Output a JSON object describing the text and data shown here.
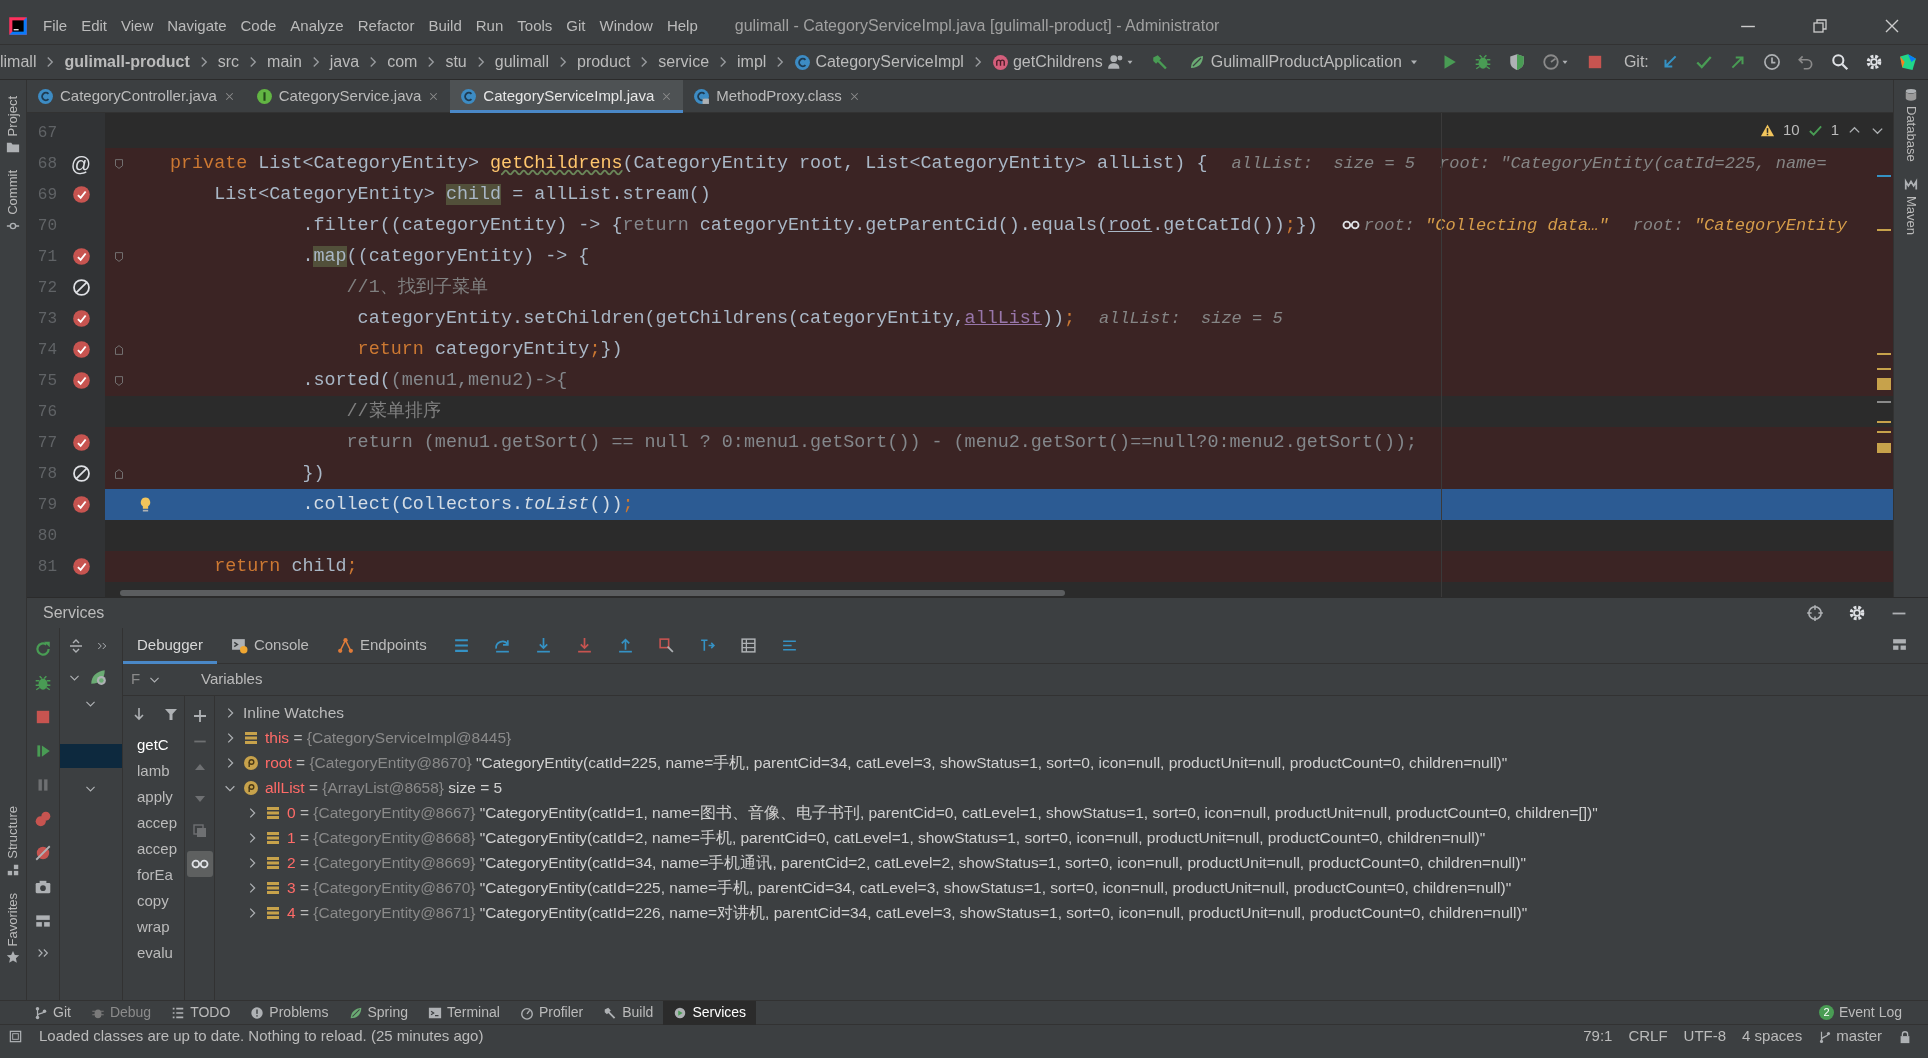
{
  "window": {
    "title": "gulimall - CategoryServiceImpl.java [gulimall-product] - Administrator"
  },
  "menu": [
    "File",
    "Edit",
    "View",
    "Navigate",
    "Code",
    "Analyze",
    "Refactor",
    "Build",
    "Run",
    "Tools",
    "Git",
    "Window",
    "Help"
  ],
  "breadcrumbs": [
    {
      "label": "limall",
      "kind": "project"
    },
    {
      "label": "gulimall-product",
      "kind": "module"
    },
    {
      "label": "src",
      "kind": "folder"
    },
    {
      "label": "main",
      "kind": "folder"
    },
    {
      "label": "java",
      "kind": "folder"
    },
    {
      "label": "com",
      "kind": "folder"
    },
    {
      "label": "stu",
      "kind": "folder"
    },
    {
      "label": "gulimall",
      "kind": "folder"
    },
    {
      "label": "product",
      "kind": "folder"
    },
    {
      "label": "service",
      "kind": "folder"
    },
    {
      "label": "impl",
      "kind": "folder"
    },
    {
      "label": "CategoryServiceImpl",
      "kind": "class"
    },
    {
      "label": "getChildrens",
      "kind": "method"
    }
  ],
  "run_config": "GulimallProductApplication",
  "git_label": "Git:",
  "tabs": [
    {
      "label": "CategoryController.java",
      "kind": "class",
      "selected": false
    },
    {
      "label": "CategoryService.java",
      "kind": "interface",
      "selected": false
    },
    {
      "label": "CategoryServiceImpl.java",
      "kind": "class",
      "selected": true
    },
    {
      "label": "MethodProxy.class",
      "kind": "compiled",
      "selected": false
    }
  ],
  "inspections": {
    "warnings": "10",
    "ok": "1"
  },
  "lines": [
    {
      "number": "67",
      "kind": "plain",
      "highlighted": false,
      "current": false,
      "fold_start": false,
      "fold_end": false,
      "bulb": false
    },
    {
      "number": "68",
      "kind": "symbol",
      "symbol": "@",
      "highlighted": true,
      "current": false,
      "fold_start": true,
      "fold_end": false,
      "bulb": false,
      "code": [
        {
          "kind": "keyword",
          "text": "private"
        },
        {
          "kind": "plain",
          "text": " List<CategoryEntity> "
        },
        {
          "kind": "typo",
          "text": "getChildrens"
        },
        {
          "kind": "plain",
          "text": "(CategoryEntity root, List<CategoryEntity> allList) {"
        }
      ],
      "hints": [
        {
          "kind": "value",
          "segments": [
            {
              "kind": "label",
              "text": "allList:  size = 5"
            }
          ]
        },
        {
          "kind": "value",
          "segments": [
            {
              "kind": "label",
              "text": "root: \"CategoryEntity(catId=225, name="
            }
          ]
        }
      ]
    },
    {
      "number": "69",
      "kind": "breakpoint",
      "highlighted": true,
      "current": false,
      "fold_start": false,
      "fold_end": false,
      "bulb": false,
      "code": [
        {
          "kind": "plain",
          "text": "    List<CategoryEntity> "
        },
        {
          "kind": "highlight",
          "text": "child"
        },
        {
          "kind": "plain",
          "text": " = allList.stream()"
        }
      ]
    },
    {
      "number": "70",
      "kind": "plain",
      "highlighted": true,
      "current": false,
      "fold_start": false,
      "fold_end": false,
      "bulb": false,
      "code": [
        {
          "kind": "plain",
          "text": "            .filter((categoryEntity) -> {"
        },
        {
          "kind": "dim",
          "text": "return"
        },
        {
          "kind": "plain",
          "text": " categoryEntity.getParentCid().equals("
        },
        {
          "kind": "param",
          "text": "root"
        },
        {
          "kind": "plain",
          "text": ".getCatId())"
        },
        {
          "kind": "keyword",
          "text": ";"
        },
        {
          "kind": "plain",
          "text": "})"
        }
      ],
      "hints": [
        {
          "kind": "watch",
          "segments": [
            {
              "kind": "label",
              "text": "root: "
            },
            {
              "kind": "value",
              "text": "\"Collecting data…\""
            }
          ]
        },
        {
          "kind": "value",
          "segments": [
            {
              "kind": "label",
              "text": "root: "
            },
            {
              "kind": "value",
              "text": "\"CategoryEntity"
            }
          ]
        }
      ]
    },
    {
      "number": "71",
      "kind": "breakpoint",
      "highlighted": true,
      "current": false,
      "fold_start": true,
      "fold_end": false,
      "bulb": false,
      "code": [
        {
          "kind": "plain",
          "text": "            ."
        },
        {
          "kind": "highlight",
          "text": "map"
        },
        {
          "kind": "plain",
          "text": "((categoryEntity) -> {"
        }
      ]
    },
    {
      "number": "72",
      "kind": "disabled-breakpoint",
      "highlighted": true,
      "current": false,
      "fold_start": false,
      "fold_end": false,
      "bulb": false,
      "code": [
        {
          "kind": "comment",
          "text": "                //1、找到子菜单"
        }
      ]
    },
    {
      "number": "73",
      "kind": "breakpoint",
      "highlighted": true,
      "current": false,
      "fold_start": false,
      "fold_end": false,
      "bulb": false,
      "code": [
        {
          "kind": "plain",
          "text": "                 categoryEntity.setChildren(getChildrens(categoryEntity,"
        },
        {
          "kind": "field",
          "text": "allList"
        },
        {
          "kind": "plain",
          "text": "))"
        },
        {
          "kind": "keyword",
          "text": ";"
        }
      ],
      "hints": [
        {
          "kind": "value",
          "segments": [
            {
              "kind": "label",
              "text": "allList:  size = 5"
            }
          ]
        }
      ]
    },
    {
      "number": "74",
      "kind": "breakpoint",
      "highlighted": true,
      "current": false,
      "fold_start": false,
      "fold_end": true,
      "bulb": false,
      "code": [
        {
          "kind": "keyword",
          "text": "                 return"
        },
        {
          "kind": "plain",
          "text": " categoryEntity"
        },
        {
          "kind": "keyword",
          "text": ";"
        },
        {
          "kind": "plain",
          "text": "})"
        }
      ]
    },
    {
      "number": "75",
      "kind": "breakpoint",
      "highlighted": true,
      "current": false,
      "fold_start": true,
      "fold_end": false,
      "bulb": false,
      "code": [
        {
          "kind": "plain",
          "text": "            .sorted("
        },
        {
          "kind": "dim",
          "text": "(menu1,menu2)->{"
        }
      ]
    },
    {
      "number": "76",
      "kind": "plain",
      "highlighted": false,
      "current": false,
      "fold_start": false,
      "fold_end": false,
      "bulb": false,
      "code": [
        {
          "kind": "comment",
          "text": "                //菜单排序"
        }
      ]
    },
    {
      "number": "77",
      "kind": "breakpoint",
      "highlighted": true,
      "current": false,
      "fold_start": false,
      "fold_end": false,
      "bulb": false,
      "code": [
        {
          "kind": "dim",
          "text": "                return (menu1.getSort() == null ? 0:menu1.getSort()) - (menu2.getSort()==null?0:menu2.getSort());"
        }
      ]
    },
    {
      "number": "78",
      "kind": "disabled-breakpoint",
      "highlighted": true,
      "current": false,
      "fold_start": false,
      "fold_end": true,
      "bulb": false,
      "code": [
        {
          "kind": "plain",
          "text": "            })"
        }
      ]
    },
    {
      "number": "79",
      "kind": "breakpoint",
      "highlighted": true,
      "current": true,
      "fold_start": false,
      "fold_end": false,
      "bulb": true,
      "code": [
        {
          "kind": "plain",
          "text": "            .collect(Collectors."
        },
        {
          "kind": "italic",
          "text": "toList"
        },
        {
          "kind": "plain",
          "text": "())"
        },
        {
          "kind": "keyword",
          "text": ";"
        }
      ]
    },
    {
      "number": "80",
      "kind": "plain",
      "highlighted": false,
      "current": false,
      "fold_start": false,
      "fold_end": false,
      "bulb": false
    },
    {
      "number": "81",
      "kind": "breakpoint",
      "highlighted": true,
      "current": false,
      "fold_start": false,
      "fold_end": false,
      "bulb": false,
      "code": [
        {
          "kind": "keyword",
          "text": "    return"
        },
        {
          "kind": "plain",
          "text": " child"
        },
        {
          "kind": "keyword",
          "text": ";"
        }
      ]
    }
  ],
  "left_stripe": [
    {
      "label": "Project",
      "kind": "folder"
    },
    {
      "label": "Commit",
      "kind": "commit"
    },
    {
      "label": "Structure",
      "kind": "structure"
    },
    {
      "label": "Favorites",
      "kind": "star"
    }
  ],
  "right_stripe": [
    {
      "label": "Database",
      "kind": "database"
    },
    {
      "label": "Maven",
      "kind": "maven"
    }
  ],
  "services": {
    "title": "Services",
    "debug_tabs": [
      {
        "label": "Debugger",
        "selected": true,
        "kind": "debugger"
      },
      {
        "label": "Console",
        "selected": false,
        "kind": "console"
      },
      {
        "label": "Endpoints",
        "selected": false,
        "kind": "endpoints"
      }
    ],
    "frames_header": "F",
    "variables_header": "Variables",
    "frames": [
      {
        "label": "getC",
        "selected": true,
        "kind": "app"
      },
      {
        "label": "lamb",
        "selected": false,
        "kind": "app"
      },
      {
        "label": "apply",
        "selected": false,
        "kind": "plain"
      },
      {
        "label": "accep",
        "selected": false,
        "kind": "library"
      },
      {
        "label": "accep",
        "selected": false,
        "kind": "library"
      },
      {
        "label": "forEa",
        "selected": false,
        "kind": "library"
      },
      {
        "label": "copy",
        "selected": false,
        "kind": "library"
      },
      {
        "label": "wrap",
        "selected": false,
        "kind": "library"
      },
      {
        "label": "evalu",
        "selected": false,
        "kind": "library"
      }
    ],
    "variables": [
      {
        "kind": "watches",
        "name": "Inline Watches",
        "expanded": false
      },
      {
        "kind": "field",
        "name": "this",
        "op": "=",
        "ref": "{CategoryServiceImpl@8445}",
        "expanded": false
      },
      {
        "kind": "param",
        "name": "root",
        "op": "=",
        "ref": "{CategoryEntity@8670}",
        "value": "\"CategoryEntity(catId=225, name=手机, parentCid=34, catLevel=3, showStatus=1, sort=0, icon=null, productUnit=null, productCount=0, children=null)\"",
        "expanded": false
      },
      {
        "kind": "param",
        "name": "allList",
        "op": "=",
        "ref": "{ArrayList@8658}",
        "value": "size = 5",
        "expanded": true,
        "children": [
          {
            "kind": "field",
            "name": "0",
            "op": "=",
            "ref": "{CategoryEntity@8667}",
            "value": "\"CategoryEntity(catId=1, name=图书、音像、电子书刊, parentCid=0, catLevel=1, showStatus=1, sort=0, icon=null, productUnit=null, productCount=0, children=[])\"",
            "expanded": false
          },
          {
            "kind": "field",
            "name": "1",
            "op": "=",
            "ref": "{CategoryEntity@8668}",
            "value": "\"CategoryEntity(catId=2, name=手机, parentCid=0, catLevel=1, showStatus=1, sort=0, icon=null, productUnit=null, productCount=0, children=null)\"",
            "expanded": false
          },
          {
            "kind": "field",
            "name": "2",
            "op": "=",
            "ref": "{CategoryEntity@8669}",
            "value": "\"CategoryEntity(catId=34, name=手机通讯, parentCid=2, catLevel=2, showStatus=1, sort=0, icon=null, productUnit=null, productCount=0, children=null)\"",
            "expanded": false
          },
          {
            "kind": "field",
            "name": "3",
            "op": "=",
            "ref": "{CategoryEntity@8670}",
            "value": "\"CategoryEntity(catId=225, name=手机, parentCid=34, catLevel=3, showStatus=1, sort=0, icon=null, productUnit=null, productCount=0, children=null)\"",
            "expanded": false
          },
          {
            "kind": "field",
            "name": "4",
            "op": "=",
            "ref": "{CategoryEntity@8671}",
            "value": "\"CategoryEntity(catId=226, name=对讲机, parentCid=34, catLevel=3, showStatus=1, sort=0, icon=null, productUnit=null, productCount=0, children=null)\"",
            "expanded": false
          }
        ]
      }
    ]
  },
  "tool_tabs": [
    {
      "label": "Git",
      "kind": "git",
      "selected": false,
      "disabled": false
    },
    {
      "label": "Debug",
      "kind": "debug",
      "selected": false,
      "disabled": true
    },
    {
      "label": "TODO",
      "kind": "todo",
      "selected": false,
      "disabled": false
    },
    {
      "label": "Problems",
      "kind": "problems",
      "selected": false,
      "disabled": false
    },
    {
      "label": "Spring",
      "kind": "spring",
      "selected": false,
      "disabled": false
    },
    {
      "label": "Terminal",
      "kind": "terminal",
      "selected": false,
      "disabled": false
    },
    {
      "label": "Profiler",
      "kind": "profiler",
      "selected": false,
      "disabled": false
    },
    {
      "label": "Build",
      "kind": "build",
      "selected": false,
      "disabled": false
    },
    {
      "label": "Services",
      "kind": "services",
      "selected": true,
      "disabled": false
    }
  ],
  "event_log": {
    "label": "Event Log",
    "count": "2"
  },
  "status_bar": {
    "message": "Loaded classes are up to date. Nothing to reload. (25 minutes ago)",
    "position": "79:1",
    "line_ending": "CRLF",
    "encoding": "UTF-8",
    "indent": "4 spaces",
    "branch": "master"
  }
}
